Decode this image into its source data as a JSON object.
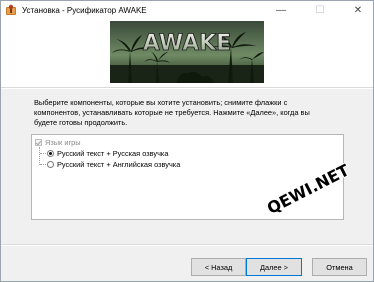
{
  "window": {
    "title": "Установка - Русификатор AWAKE",
    "minimize_glyph": "—",
    "maximize_glyph": "☐",
    "close_glyph": "✕",
    "icon": "installer-icon"
  },
  "banner": {
    "title_art": "AWAKE"
  },
  "instructions": "Выберите компоненты, которые вы хотите установить; снимите флажки с компонентов, устанавливать которые не требуется. Нажмите «Далее», когда вы будете готовы продолжить.",
  "components": {
    "group_label": "Язык игры",
    "group_checked": true,
    "options": [
      {
        "label": "Русский текст + Русская озвучка",
        "selected": true
      },
      {
        "label": "Русский текст + Английская озвучка",
        "selected": false
      }
    ]
  },
  "watermark": "QEWI.NET",
  "buttons": {
    "back": "< Назад",
    "next": "Далее >",
    "cancel": "Отмена"
  }
}
